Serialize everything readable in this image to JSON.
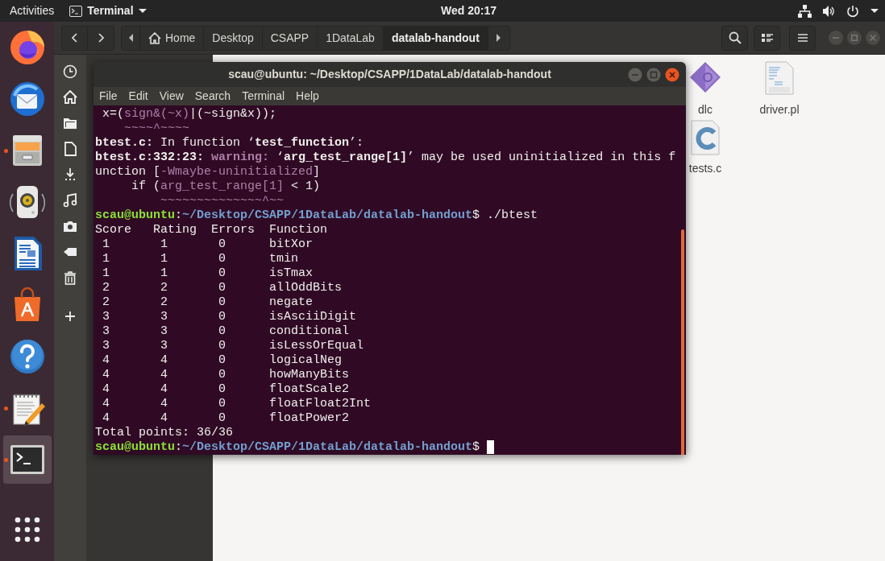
{
  "top_bar": {
    "activities": "Activities",
    "app_menu": "Terminal",
    "clock": "Wed 20:17"
  },
  "dock": {
    "items": [
      {
        "running": false,
        "selected": false
      },
      {
        "running": false,
        "selected": false
      },
      {
        "running": true,
        "selected": false
      },
      {
        "running": false,
        "selected": false
      },
      {
        "running": false,
        "selected": false
      },
      {
        "running": false,
        "selected": false
      },
      {
        "running": false,
        "selected": false
      },
      {
        "running": true,
        "selected": false
      },
      {
        "running": true,
        "selected": true
      }
    ]
  },
  "file_manager": {
    "path": [
      {
        "label": "Home",
        "selected": false
      },
      {
        "label": "Desktop",
        "selected": false
      },
      {
        "label": "CSAPP",
        "selected": false
      },
      {
        "label": "1DataLab",
        "selected": false
      },
      {
        "label": "datalab-handout",
        "selected": true
      }
    ],
    "files": [
      {
        "name": "dlc"
      },
      {
        "name": "driver.pl"
      },
      {
        "name": "tests.c"
      }
    ]
  },
  "terminal": {
    "title": "scau@ubuntu: ~/Desktop/CSAPP/1DataLab/datalab-handout",
    "menu": [
      "File",
      "Edit",
      "View",
      "Search",
      "Terminal",
      "Help"
    ],
    "lines": [
      {
        "kind": "text",
        "segments": [
          {
            "text": " x=(",
            "kind": "normal"
          },
          {
            "text": "sign&(~x)",
            "kind": "accent"
          },
          {
            "text": "|(~sign&x));",
            "kind": "normal"
          }
        ]
      },
      {
        "kind": "text",
        "segments": [
          {
            "text": "    ~~~~^~~~~",
            "kind": "accent"
          }
        ]
      },
      {
        "kind": "text",
        "segments": [
          {
            "text": "btest.c:",
            "kind": "bold"
          },
          {
            "text": " In function ‘",
            "kind": "normal"
          },
          {
            "text": "test_function",
            "kind": "bold"
          },
          {
            "text": "’:",
            "kind": "normal"
          }
        ]
      },
      {
        "kind": "text",
        "segments": [
          {
            "text": "btest.c:332:23: ",
            "kind": "bold"
          },
          {
            "text": "warning:",
            "kind": "accent_bold"
          },
          {
            "text": " ‘",
            "kind": "normal"
          },
          {
            "text": "arg_test_range[1]",
            "kind": "bold"
          },
          {
            "text": "’ may be used uninitialized in this f",
            "kind": "normal"
          }
        ]
      },
      {
        "kind": "text",
        "segments": [
          {
            "text": "unction [",
            "kind": "normal"
          },
          {
            "text": "-Wmaybe-uninitialized",
            "kind": "accent"
          },
          {
            "text": "]",
            "kind": "normal"
          }
        ]
      },
      {
        "kind": "text",
        "segments": [
          {
            "text": "     if (",
            "kind": "normal"
          },
          {
            "text": "arg_test_range[1]",
            "kind": "accent"
          },
          {
            "text": " < 1)",
            "kind": "normal"
          }
        ]
      },
      {
        "kind": "text",
        "segments": [
          {
            "text": "         ~~~~~~~~~~~~~~^~~",
            "kind": "accent"
          }
        ]
      },
      {
        "kind": "text",
        "segments": [
          {
            "text": "scau@ubuntu",
            "kind": "user"
          },
          {
            "text": ":",
            "kind": "normal"
          },
          {
            "text": "~/Desktop/CSAPP/1DataLab/datalab-handout",
            "kind": "path"
          },
          {
            "text": "$ ./btest",
            "kind": "normal"
          }
        ]
      },
      {
        "kind": "header",
        "cells": [
          "Score",
          "Rating",
          "Errors",
          "Function"
        ]
      },
      {
        "kind": "row",
        "cells": [
          "1",
          "1",
          "0",
          "bitXor"
        ]
      },
      {
        "kind": "row",
        "cells": [
          "1",
          "1",
          "0",
          "tmin"
        ]
      },
      {
        "kind": "row",
        "cells": [
          "1",
          "1",
          "0",
          "isTmax"
        ]
      },
      {
        "kind": "row",
        "cells": [
          "2",
          "2",
          "0",
          "allOddBits"
        ]
      },
      {
        "kind": "row",
        "cells": [
          "2",
          "2",
          "0",
          "negate"
        ]
      },
      {
        "kind": "row",
        "cells": [
          "3",
          "3",
          "0",
          "isAsciiDigit"
        ]
      },
      {
        "kind": "row",
        "cells": [
          "3",
          "3",
          "0",
          "conditional"
        ]
      },
      {
        "kind": "row",
        "cells": [
          "3",
          "3",
          "0",
          "isLessOrEqual"
        ]
      },
      {
        "kind": "row",
        "cells": [
          "4",
          "4",
          "0",
          "logicalNeg"
        ]
      },
      {
        "kind": "row",
        "cells": [
          "4",
          "4",
          "0",
          "howManyBits"
        ]
      },
      {
        "kind": "row",
        "cells": [
          "4",
          "4",
          "0",
          "floatScale2"
        ]
      },
      {
        "kind": "row",
        "cells": [
          "4",
          "4",
          "0",
          "floatFloat2Int"
        ]
      },
      {
        "kind": "row",
        "cells": [
          "4",
          "4",
          "0",
          "floatPower2"
        ]
      },
      {
        "kind": "text",
        "segments": [
          {
            "text": "Total points: 36/36",
            "kind": "normal"
          }
        ]
      },
      {
        "kind": "text",
        "segments": [
          {
            "text": "scau@ubuntu",
            "kind": "user"
          },
          {
            "text": ":",
            "kind": "normal"
          },
          {
            "text": "~/Desktop/CSAPP/1DataLab/datalab-handout",
            "kind": "path"
          },
          {
            "text": "$ ",
            "kind": "normal"
          }
        ]
      }
    ],
    "cursor": true
  }
}
